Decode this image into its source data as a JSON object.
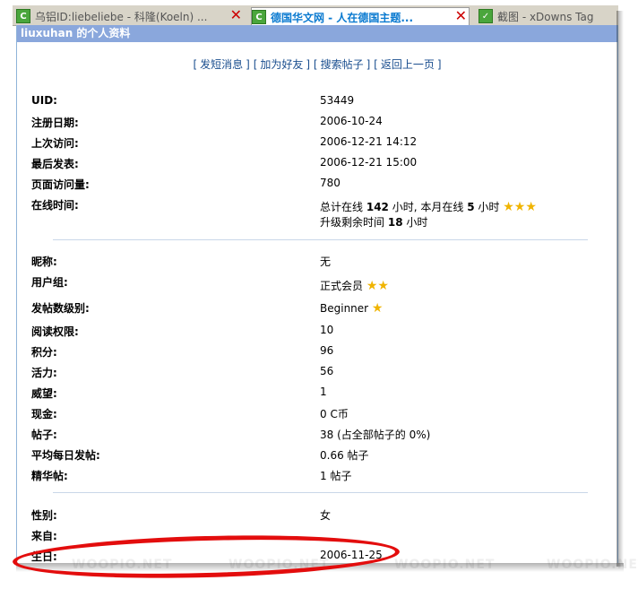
{
  "tabs": [
    {
      "title": "乌铝ID:liebeliebe - 科隆(Koeln) ..."
    },
    {
      "title": "德国华文网 - 人在德国主题..."
    },
    {
      "title": "截图 - xDowns Tag"
    }
  ],
  "panel": {
    "title": "liuxuhan 的个人资料"
  },
  "actions": {
    "send_pm": "发短消息",
    "add_friend": "加为好友",
    "search_posts": "搜索帖子",
    "back": "返回上一页"
  },
  "basic": {
    "uid": {
      "label": "UID:",
      "value": "53449"
    },
    "reg_date": {
      "label": "注册日期:",
      "value": "2006-10-24"
    },
    "last_visit": {
      "label": "上次访问:",
      "value": "2006-12-21 14:12"
    },
    "last_post": {
      "label": "最后发表:",
      "value": "2006-12-21 15:00"
    },
    "page_views": {
      "label": "页面访问量:",
      "value": "780"
    },
    "online": {
      "label": "在线时间:",
      "line1_pre": "总计在线",
      "total_hours": "142",
      "line1_mid": "小时, 本月在线",
      "month_hours": "5",
      "line1_post": "小时",
      "stars": "★★★",
      "line2_pre": "升级剩余时间",
      "remain_hours": "18",
      "line2_post": "小时"
    }
  },
  "stats": {
    "nickname": {
      "label": "昵称:",
      "value": "无"
    },
    "group": {
      "label": "用户组:",
      "value": "正式会员",
      "stars": "★★"
    },
    "post_level": {
      "label": "发帖数级别:",
      "value": "Beginner",
      "stars": "★"
    },
    "read_perm": {
      "label": "阅读权限:",
      "value": "10"
    },
    "points": {
      "label": "积分:",
      "value": "96"
    },
    "activity": {
      "label": "活力:",
      "value": "56"
    },
    "prestige": {
      "label": "威望:",
      "value": "1"
    },
    "cash": {
      "label": "现金:",
      "value": "0 C币"
    },
    "posts": {
      "label": "帖子:",
      "value": "38 (占全部帖子的 0%)"
    },
    "avg_posts": {
      "label": "平均每日发帖:",
      "value": "0.66 帖子"
    },
    "digest": {
      "label": "精华帖:",
      "value": "1 帖子"
    }
  },
  "personal": {
    "gender": {
      "label": "性别:",
      "value": "女"
    },
    "from": {
      "label": "来自:",
      "value": ""
    },
    "birthday": {
      "label": "生日:",
      "value": "2006-11-25"
    }
  },
  "watermark": "WOOPIO.NET",
  "colors": {
    "header": "#8aa7dc",
    "link": "#1a4e8f",
    "highlight": "#e30d0d",
    "star": "#f0b400"
  }
}
